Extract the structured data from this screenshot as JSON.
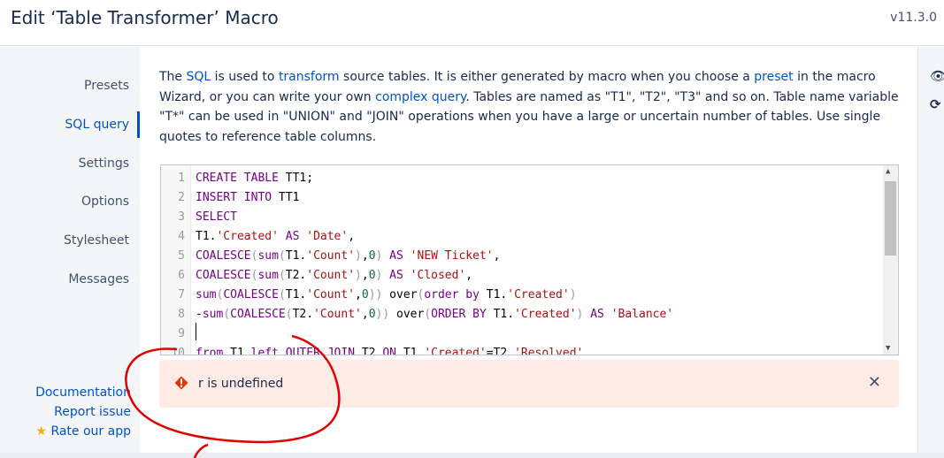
{
  "header": {
    "title": "Edit ‘Table Transformer’ Macro",
    "version": "v11.3.0"
  },
  "sidebar": {
    "items": [
      {
        "label": "Presets"
      },
      {
        "label": "SQL query",
        "active": true
      },
      {
        "label": "Settings"
      },
      {
        "label": "Options"
      },
      {
        "label": "Stylesheet"
      },
      {
        "label": "Messages"
      }
    ],
    "links": {
      "documentation": "Documentation",
      "report": "Report issue",
      "rate": "Rate our app"
    }
  },
  "description": {
    "t1": "The ",
    "sql": "SQL",
    "t2": " is used to ",
    "transform": "transform",
    "t3": " source tables. It is either generated by macro when you choose a ",
    "preset": "preset",
    "t4": " in the macro Wizard, or you can write your own ",
    "complex": "complex query",
    "t5": ". Tables are named as \"T1\", \"T2\", \"T3\" and so on. Table name variable \"T*\" can be used in \"UNION\" and \"JOIN\" operations when you have a large or uncertain number of tables. Use single quotes to reference table columns."
  },
  "editor": {
    "lines": [
      [
        [
          "kw",
          "CREATE TABLE "
        ],
        [
          "pl",
          "TT1;"
        ]
      ],
      [
        [
          "kw",
          "INSERT INTO "
        ],
        [
          "pl",
          "TT1"
        ]
      ],
      [
        [
          "kw",
          "SELECT"
        ]
      ],
      [
        [
          "pl",
          "T1."
        ],
        [
          "str",
          "'Created'"
        ],
        [
          "kw",
          " AS "
        ],
        [
          "str",
          "'Date'"
        ],
        [
          "pl",
          ","
        ]
      ],
      [
        [
          "kw",
          "COALESCE"
        ],
        [
          "pn",
          "("
        ],
        [
          "kw",
          "sum"
        ],
        [
          "pn",
          "("
        ],
        [
          "pl",
          "T1."
        ],
        [
          "str",
          "'Count'"
        ],
        [
          "pn",
          ")"
        ],
        [
          "pl",
          ","
        ],
        [
          "num",
          "0"
        ],
        [
          "pn",
          ")"
        ],
        [
          "kw",
          " AS "
        ],
        [
          "str",
          "'NEW Ticket'"
        ],
        [
          "pl",
          ","
        ]
      ],
      [
        [
          "kw",
          "COALESCE"
        ],
        [
          "pn",
          "("
        ],
        [
          "kw",
          "sum"
        ],
        [
          "pn",
          "("
        ],
        [
          "pl",
          "T2."
        ],
        [
          "str",
          "'Count'"
        ],
        [
          "pn",
          ")"
        ],
        [
          "pl",
          ","
        ],
        [
          "num",
          "0"
        ],
        [
          "pn",
          ")"
        ],
        [
          "kw",
          " AS "
        ],
        [
          "str",
          "'Closed'"
        ],
        [
          "pl",
          ","
        ]
      ],
      [
        [
          "kw",
          "sum"
        ],
        [
          "pn",
          "("
        ],
        [
          "kw",
          "COALESCE"
        ],
        [
          "pn",
          "("
        ],
        [
          "pl",
          "T1."
        ],
        [
          "str",
          "'Count'"
        ],
        [
          "pl",
          ","
        ],
        [
          "num",
          "0"
        ],
        [
          "pn",
          "))"
        ],
        [
          "pl",
          " over"
        ],
        [
          "pn",
          "("
        ],
        [
          "kw",
          "order by "
        ],
        [
          "pl",
          "T1."
        ],
        [
          "str",
          "'Created'"
        ],
        [
          "pn",
          ")"
        ]
      ],
      [
        [
          "pl",
          "-"
        ],
        [
          "kw",
          "sum"
        ],
        [
          "pn",
          "("
        ],
        [
          "kw",
          "COALESCE"
        ],
        [
          "pn",
          "("
        ],
        [
          "pl",
          "T2."
        ],
        [
          "str",
          "'Count'"
        ],
        [
          "pl",
          ","
        ],
        [
          "num",
          "0"
        ],
        [
          "pn",
          "))"
        ],
        [
          "pl",
          " over"
        ],
        [
          "pn",
          "("
        ],
        [
          "kw",
          "ORDER BY "
        ],
        [
          "pl",
          "T1."
        ],
        [
          "str",
          "'Created'"
        ],
        [
          "pn",
          ")"
        ],
        [
          "kw",
          " AS "
        ],
        [
          "str",
          "'Balance'"
        ]
      ],
      [],
      [
        [
          "kw",
          "from "
        ],
        [
          "pl",
          "T1 "
        ],
        [
          "kw",
          "left OUTER JOIN "
        ],
        [
          "pl",
          "T2 "
        ],
        [
          "kw",
          "ON "
        ],
        [
          "pl",
          "T1."
        ],
        [
          "str",
          "'Created'"
        ],
        [
          "pl",
          "=T2."
        ],
        [
          "str",
          "'Resolved'"
        ]
      ]
    ]
  },
  "error": {
    "message": "r is undefined",
    "icon": "warning-icon",
    "close_icon": "close-icon"
  },
  "rail": {
    "icons": [
      "eye-icon",
      "refresh-icon"
    ]
  },
  "colors": {
    "accent": "#0052cc",
    "error_bg": "#ffebe6",
    "annotation": "#e00000"
  }
}
